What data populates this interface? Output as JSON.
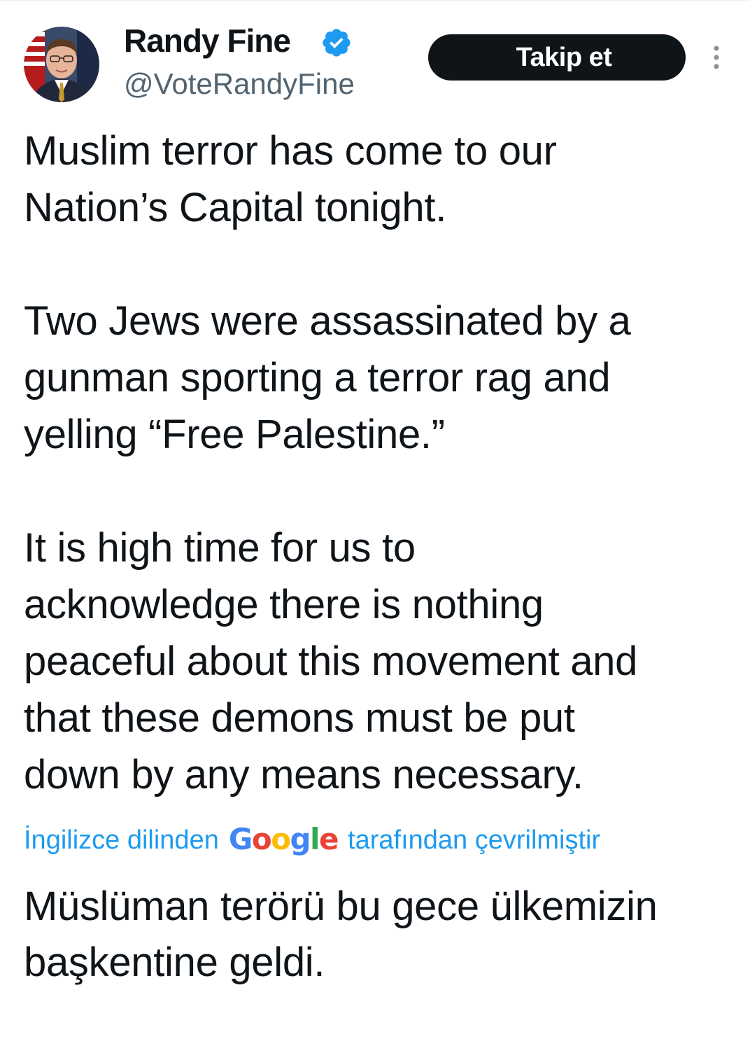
{
  "author": {
    "display_name": "Randy Fine",
    "handle": "@VoteRandyFine",
    "verified": true,
    "avatar_icon": "profile-photo"
  },
  "actions": {
    "follow_label": "Takip et",
    "more_icon": "vertical-ellipsis-icon"
  },
  "tweet": {
    "text": "Muslim terror has come to our\nNation’s Capital tonight.\n\nTwo Jews were assassinated by a\ngunman sporting a terror rag and\nyelling “Free Palestine.”\n\nIt is high time for us to\nacknowledge there is nothing\npeaceful about this movement and\nthat these demons must be put\ndown by any means necessary."
  },
  "translation": {
    "prefix": "İngilizce dilinden",
    "provider": "Google",
    "suffix": "tarafından çevrilmiştir",
    "text": "Müslüman terörü bu gece ülkemizin\nbaşkentine geldi."
  },
  "colors": {
    "link_blue": "#1d9bf0",
    "text_primary": "#0f1419",
    "text_secondary": "#536471",
    "button_bg": "#0f1419"
  }
}
